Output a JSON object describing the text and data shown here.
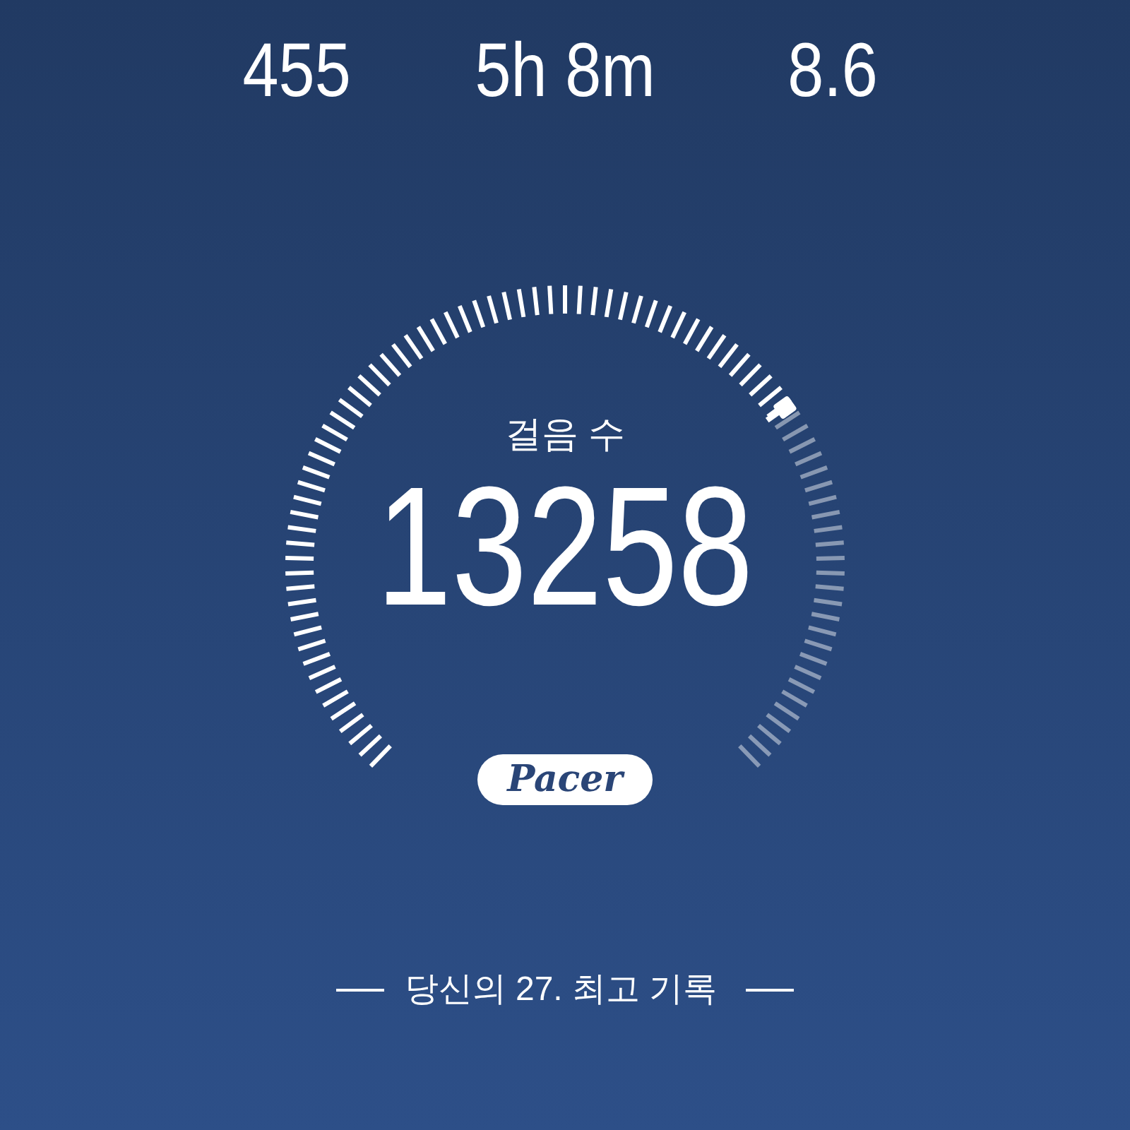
{
  "stats": [
    {
      "value": "455"
    },
    {
      "value": "5h 8m"
    },
    {
      "value": "8.6"
    }
  ],
  "gauge": {
    "label": "걸음 수",
    "value": "13258"
  },
  "logo": {
    "text": "Pacer"
  },
  "record": {
    "text": "당신의 27. 최고 기록"
  }
}
